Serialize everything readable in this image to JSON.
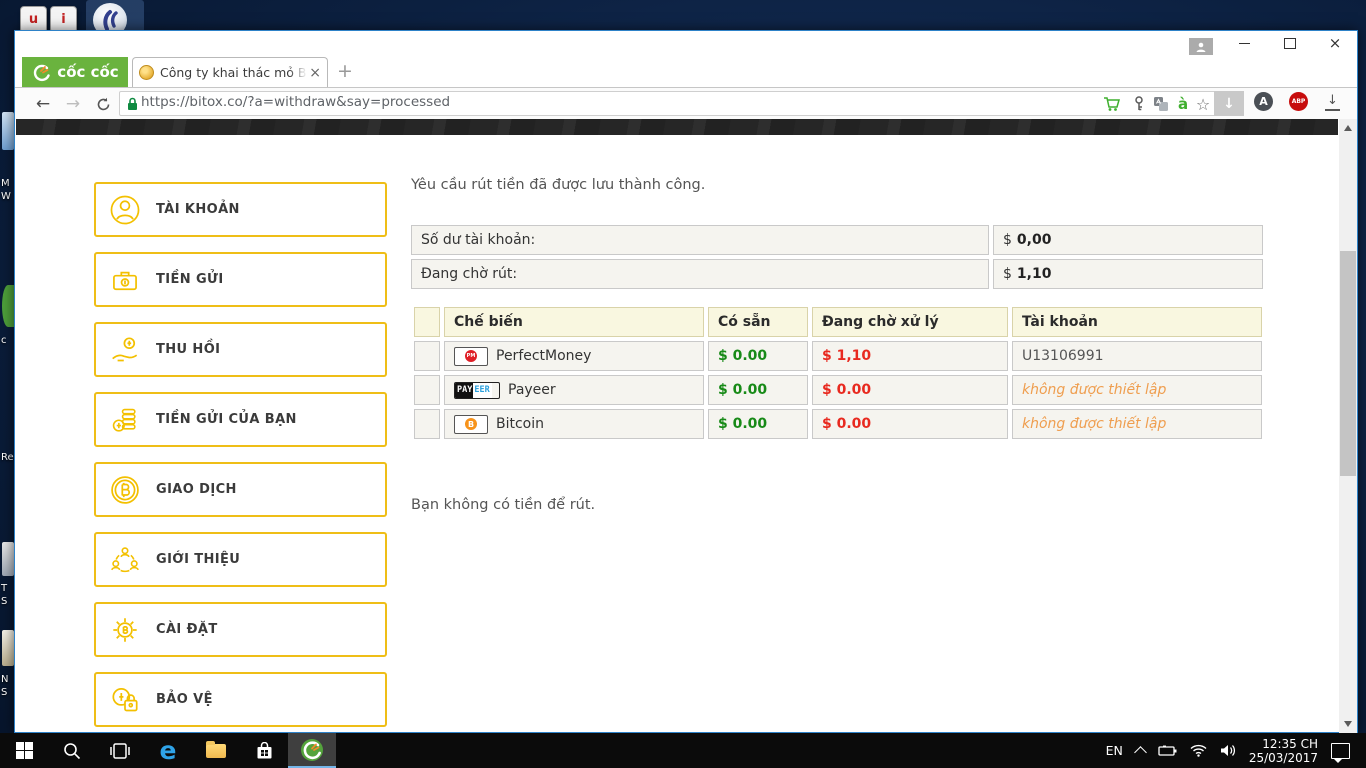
{
  "desktop": {
    "shortcut_u": "u",
    "shortcut_i": "i",
    "strip": {
      "l1": "M",
      "l2": "W",
      "l3": "c",
      "l4": "Re",
      "l5": "T",
      "l6": "S",
      "l7": "N",
      "l8": "S"
    }
  },
  "browser": {
    "brand": "cốc cốc",
    "tab": {
      "title": "Công ty khai thác mỏ Bito",
      "close": "×",
      "new_tab": "+"
    },
    "controls": {
      "close": "×"
    },
    "toolbar": {
      "back": "←",
      "forward": "→",
      "url": "https://bitox.co/?a=withdraw&say=processed",
      "viet_icon": "à",
      "star": "☆",
      "download_box": "↓",
      "ext_a": "A",
      "ext_abp": "ABP",
      "download": "↓"
    }
  },
  "page": {
    "sidebar": {
      "items": [
        {
          "label": "TÀI KHOẢN"
        },
        {
          "label": "TIỀN GỬI"
        },
        {
          "label": "THU HỒI"
        },
        {
          "label": "TIỀN GỬI CỦA BẠN"
        },
        {
          "label": "GIAO DỊCH"
        },
        {
          "label": "GIỚI THIỆU"
        },
        {
          "label": "CÀI ĐẶT"
        },
        {
          "label": "BẢO VỆ"
        }
      ]
    },
    "main": {
      "success_message": "Yêu cầu rút tiền đã được lưu thành công.",
      "balance_rows": [
        {
          "label": "Số dư tài khoản:",
          "currency": "$",
          "amount": "0,00"
        },
        {
          "label": "Đang chờ rút:",
          "currency": "$",
          "amount": "1,10"
        }
      ],
      "table": {
        "headers": [
          "",
          "Chế biến",
          "Có sẵn",
          "Đang chờ xử lý",
          "Tài khoản"
        ],
        "rows": [
          {
            "method": "PerfectMoney",
            "badge": "PM",
            "available": "$ 0.00",
            "pending": "$ 1,10",
            "account": "U13106991"
          },
          {
            "method": "Payeer",
            "badge_pay": "PAY",
            "badge_eer": "EER",
            "available": "$ 0.00",
            "pending": "$ 0.00",
            "account": "không được thiết lập"
          },
          {
            "method": "Bitcoin",
            "badge": "B",
            "available": "$ 0.00",
            "pending": "$ 0.00",
            "account": "không được thiết lập"
          }
        ]
      },
      "empty_message": "Bạn không có tiền để rút."
    }
  },
  "taskbar": {
    "edge_label": "e",
    "tray": {
      "lang": "EN",
      "time": "12:35 CH",
      "date": "25/03/2017"
    }
  }
}
